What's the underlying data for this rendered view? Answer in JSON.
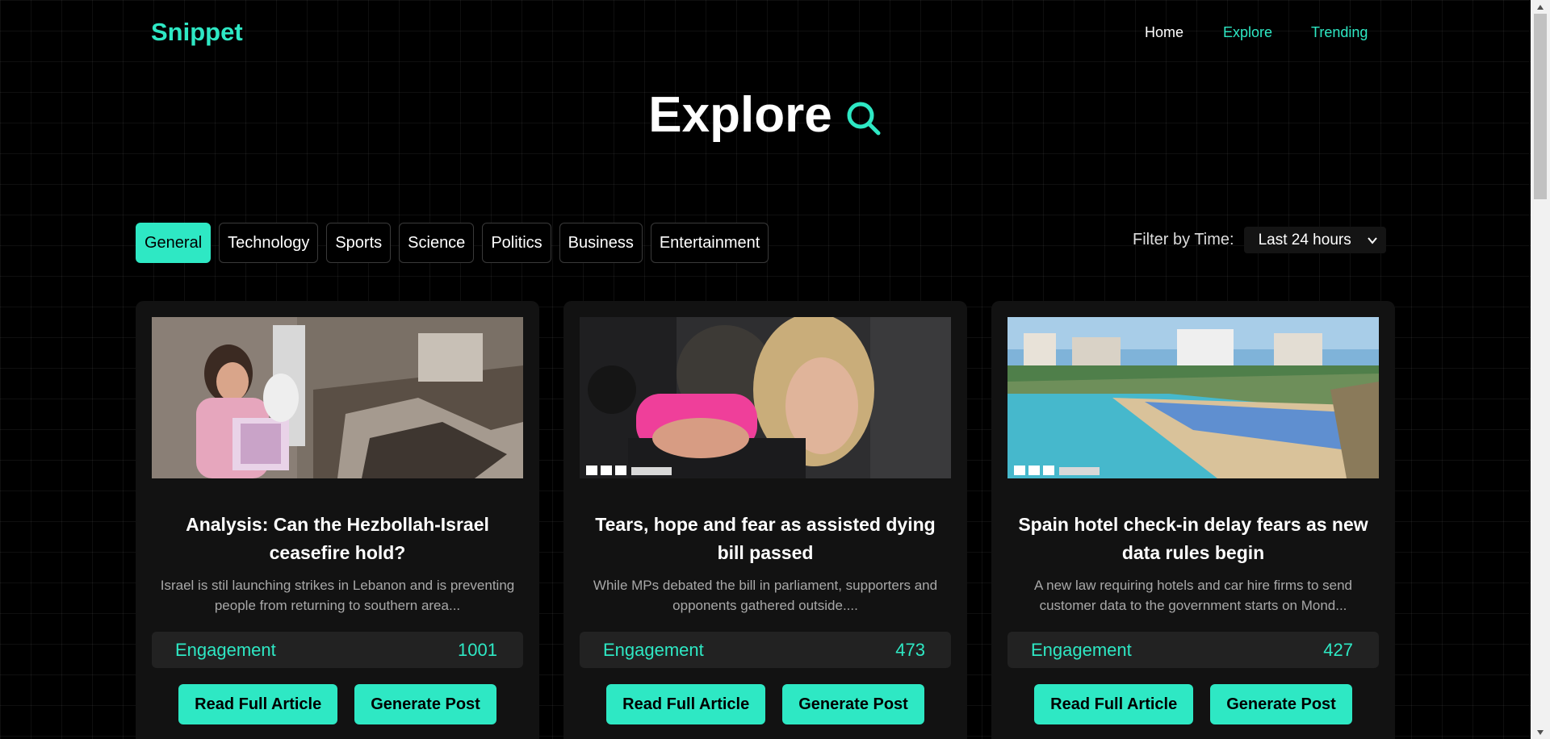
{
  "header": {
    "logo": "Snippet",
    "nav": {
      "home": "Home",
      "explore": "Explore",
      "trending": "Trending"
    }
  },
  "hero": {
    "title": "Explore"
  },
  "categories": [
    "General",
    "Technology",
    "Sports",
    "Science",
    "Politics",
    "Business",
    "Entertainment"
  ],
  "active_category": "General",
  "time_filter": {
    "label": "Filter by Time:",
    "selected": "Last 24 hours"
  },
  "cards": [
    {
      "title": "Analysis: Can the Hezbollah-Israel ceasefire hold?",
      "description": "Israel is stil launching strikes in Lebanon and is preventing people from returning to southern area...",
      "engagement_label": "Engagement",
      "engagement": "1001",
      "read_label": "Read Full Article",
      "generate_label": "Generate Post"
    },
    {
      "title": "Tears, hope and fear as assisted dying bill passed",
      "description": "While MPs debated the bill in parliament, supporters and opponents gathered outside....",
      "engagement_label": "Engagement",
      "engagement": "473",
      "read_label": "Read Full Article",
      "generate_label": "Generate Post"
    },
    {
      "title": "Spain hotel check-in delay fears as new data rules begin",
      "description": "A new law requiring hotels and car hire firms to send customer data to the government starts on Mond...",
      "engagement_label": "Engagement",
      "engagement": "427",
      "read_label": "Read Full Article",
      "generate_label": "Generate Post"
    }
  ],
  "colors": {
    "accent": "#2ee8c4",
    "background": "#000000",
    "card": "#121212"
  }
}
